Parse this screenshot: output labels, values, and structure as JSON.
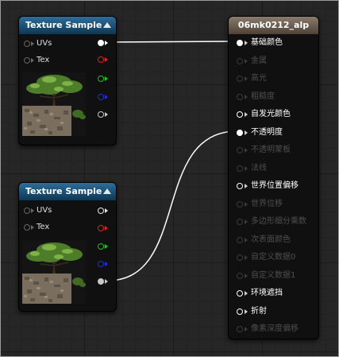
{
  "nodes": {
    "texture_sample_1": {
      "title": "Texture Sample",
      "inputs": [
        "UVs",
        "Tex"
      ],
      "outputs": [
        {
          "name": "rgb",
          "color": "#ffffff",
          "connected": true
        },
        {
          "name": "r",
          "color": "#e02020",
          "connected": false
        },
        {
          "name": "g",
          "color": "#20c020",
          "connected": false
        },
        {
          "name": "b",
          "color": "#2030e0",
          "connected": false
        },
        {
          "name": "a",
          "color": "#c8c8c8",
          "connected": false
        }
      ]
    },
    "texture_sample_2": {
      "title": "Texture Sample",
      "inputs": [
        "UVs",
        "Tex"
      ],
      "outputs": [
        {
          "name": "rgb",
          "color": "#e8e8e8",
          "connected": false
        },
        {
          "name": "r",
          "color": "#e02020",
          "connected": false
        },
        {
          "name": "g",
          "color": "#20c020",
          "connected": false
        },
        {
          "name": "b",
          "color": "#2030e0",
          "connected": false
        },
        {
          "name": "a",
          "color": "#c8c8c8",
          "connected": true
        }
      ]
    },
    "material": {
      "title": "06mk0212_alp",
      "inputs": [
        {
          "label": "基础颜色",
          "active": true,
          "connected": true
        },
        {
          "label": "金属",
          "active": false,
          "connected": false
        },
        {
          "label": "高光",
          "active": false,
          "connected": false
        },
        {
          "label": "粗糙度",
          "active": false,
          "connected": false
        },
        {
          "label": "自发光颜色",
          "active": true,
          "connected": false
        },
        {
          "label": "不透明度",
          "active": true,
          "connected": true
        },
        {
          "label": "不透明蒙板",
          "active": false,
          "connected": false
        },
        {
          "label": "法线",
          "active": false,
          "connected": false
        },
        {
          "label": "世界位置偏移",
          "active": true,
          "connected": false
        },
        {
          "label": "世界位移",
          "active": false,
          "connected": false
        },
        {
          "label": "多边形细分乘数",
          "active": false,
          "connected": false
        },
        {
          "label": "次表面颜色",
          "active": false,
          "connected": false
        },
        {
          "label": "自定义数据0",
          "active": false,
          "connected": false
        },
        {
          "label": "自定义数据1",
          "active": false,
          "connected": false
        },
        {
          "label": "环境遮挡",
          "active": true,
          "connected": false
        },
        {
          "label": "折射",
          "active": true,
          "connected": false
        },
        {
          "label": "像素深度偏移",
          "active": false,
          "connected": false
        }
      ]
    }
  },
  "colors": {
    "wire": "#ffffff",
    "texture_header": "#1e5a82",
    "material_header": "#6d5f52",
    "inactive_text": "#4e4e4e"
  }
}
